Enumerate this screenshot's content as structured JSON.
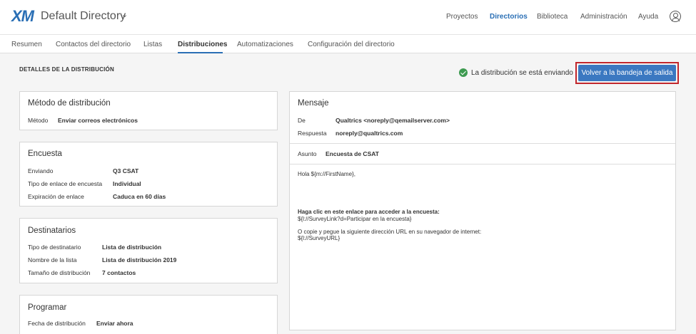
{
  "header": {
    "logo": "XM",
    "directory_title": "Default Directory",
    "nav": [
      "Proyectos",
      "Directorios",
      "Biblioteca",
      "Administración",
      "Ayuda"
    ]
  },
  "tabs": [
    "Resumen",
    "Contactos del directorio",
    "Listas",
    "Distribuciones",
    "Automatizaciones",
    "Configuración del directorio"
  ],
  "section_title": "DETALLES DE LA DISTRIBUCIÓN",
  "status_text": "La distribución se está enviando",
  "back_button": "Volver a la bandeja de salida",
  "method_card": {
    "title": "Método de distribución",
    "label": "Método",
    "value": "Enviar correos electrónicos"
  },
  "survey_card": {
    "title": "Encuesta",
    "rows": [
      {
        "label": "Enviando",
        "value": "Q3 CSAT"
      },
      {
        "label": "Tipo de enlace de encuesta",
        "value": "Individual"
      },
      {
        "label": "Expiración de enlace",
        "value": "Caduca en 60 días"
      }
    ]
  },
  "recipients_card": {
    "title": "Destinatarios",
    "rows": [
      {
        "label": "Tipo de destinatario",
        "value": "Lista de distribución"
      },
      {
        "label": "Nombre de la lista",
        "value": "Lista de distribución 2019"
      },
      {
        "label": "Tamaño de distribución",
        "value": "7 contactos"
      }
    ]
  },
  "schedule_card": {
    "title": "Programar",
    "label": "Fecha de distribución",
    "value": "Enviar ahora"
  },
  "message_card": {
    "title": "Mensaje",
    "from_label": "De",
    "from_value": "Qualtrics <noreply@qemailserver.com>",
    "reply_label": "Respuesta",
    "reply_value": "noreply@qualtrics.com",
    "subject_label": "Asunto",
    "subject_value": "Encuesta de CSAT",
    "body": {
      "greeting": "Hola ${m://FirstName},",
      "link_heading": "Haga clic en este enlace para acceder a la encuesta:",
      "link": "${l://SurveyLink?d=Participar en la encuesta}",
      "copy_text": "O copie y pegue la siguiente dirección URL en su navegador de internet:",
      "url": "${l://SurveyURL}"
    }
  }
}
